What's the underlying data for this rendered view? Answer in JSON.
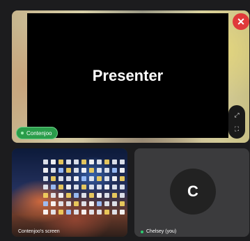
{
  "main_tile": {
    "presenter_label": "Presenter",
    "participant_name": "Contenjoo",
    "close_symbol": "✕",
    "expand_icon": "expand-icon",
    "fullscreen_icon": "fullscreen-icon"
  },
  "thumbnails": [
    {
      "caption": "Contenjoo's screen"
    },
    {
      "avatar_initial": "C",
      "caption": "Chelsey (you)"
    }
  ],
  "colors": {
    "close_button": "#e0393a",
    "active_speaker": "#2a9d4a",
    "presence": "#2ecc71"
  }
}
